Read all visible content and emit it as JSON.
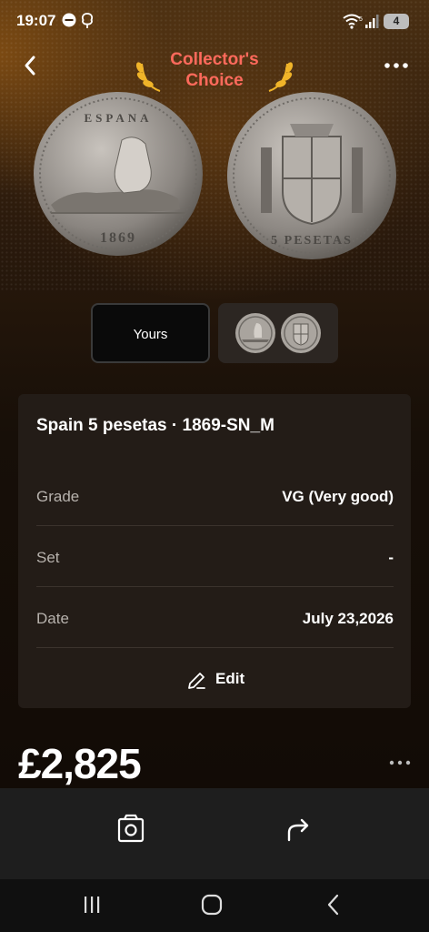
{
  "status_bar": {
    "time": "19:07",
    "battery": "4",
    "icons": [
      "minus-circle-icon",
      "tree-icon",
      "wifi-icon",
      "signal-icon",
      "battery-icon"
    ]
  },
  "header": {
    "brand_line1": "Collector's",
    "brand_line2": "Choice",
    "brand_color": "#ff6a5c",
    "laurel_color": "#f0b429"
  },
  "coin": {
    "obverse_text": "ESPANA",
    "obverse_year": "1869",
    "reverse_text": "5 PESETAS"
  },
  "view_toggle": {
    "selected_label": "Yours"
  },
  "item": {
    "title": "Spain 5 pesetas · 1869-SN_M",
    "rows": [
      {
        "label": "Grade",
        "value": "VG (Very good)"
      },
      {
        "label": "Set",
        "value": "-"
      },
      {
        "label": "Date",
        "value": "July 23,2026"
      }
    ],
    "edit_label": "Edit"
  },
  "price": "£2,825",
  "actions": [
    "photo-icon",
    "share-icon"
  ],
  "nav": [
    "recent-apps-icon",
    "home-icon",
    "back-icon"
  ]
}
